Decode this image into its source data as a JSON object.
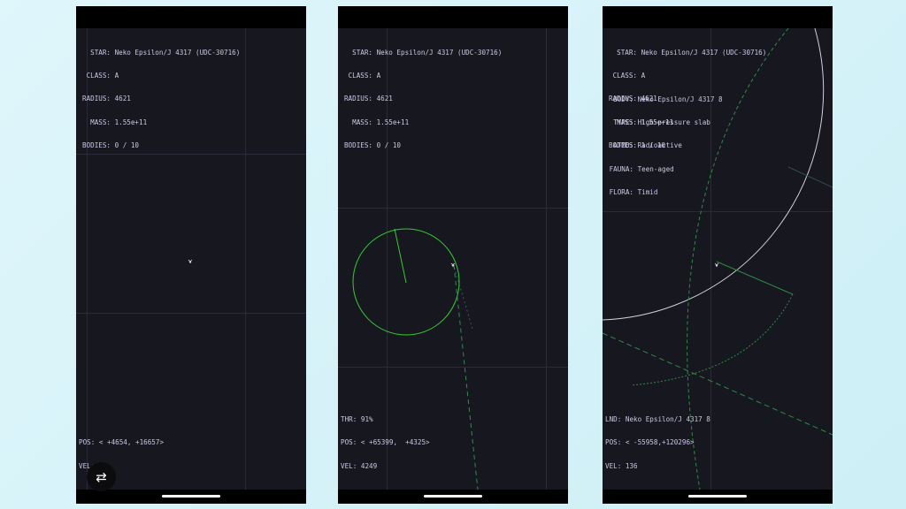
{
  "screens": [
    {
      "star": {
        "star_label": "STAR:",
        "star_value": "Neko Epsilon/J 4317 (UDC-30716)",
        "class_label": "CLASS:",
        "class_value": "A",
        "radius_label": "RADIUS:",
        "radius_value": "4621",
        "mass_label": "MASS:",
        "mass_value": "1.55e+11",
        "bodies_label": "BODIES:",
        "bodies_value": "0 / 10"
      },
      "bottom": {
        "pos_label": "POS:",
        "pos_value": "< +4654, +16657>",
        "vel_label": "VEL:",
        "vel_value": ""
      }
    },
    {
      "star": {
        "star_label": "STAR:",
        "star_value": "Neko Epsilon/J 4317 (UDC-30716)",
        "class_label": "CLASS:",
        "class_value": "A",
        "radius_label": "RADIUS:",
        "radius_value": "4621",
        "mass_label": "MASS:",
        "mass_value": "1.55e+11",
        "bodies_label": "BODIES:",
        "bodies_value": "0 / 10"
      },
      "bottom": {
        "thr_label": "THR:",
        "thr_value": "91%",
        "pos_label": "POS:",
        "pos_value": "< +65399,  +4325>",
        "vel_label": "VEL:",
        "vel_value": "4249"
      }
    },
    {
      "star": {
        "star_label": "STAR:",
        "star_value": "Neko Epsilon/J 4317 (UDC-30716)",
        "class_label": "CLASS:",
        "class_value": "A",
        "radius_label": "RADIUS:",
        "radius_value": "4621",
        "mass_label": "MASS:",
        "mass_value": "1.55e+11",
        "bodies_label": "BODIES:",
        "bodies_value": "1 / 10"
      },
      "body": {
        "body_label": "BODY:",
        "body_value": "Neko Epsilon/J 4317 8",
        "type_label": "TYPE:",
        "type_value": "High-pressure slab",
        "atmo_label": "ATMO:",
        "atmo_value": "Radioactive",
        "fauna_label": "FAUNA:",
        "fauna_value": "Teen-aged",
        "flora_label": "FLORA:",
        "flora_value": "Timid"
      },
      "bottom": {
        "lnd_label": "LND:",
        "lnd_value": "Neko Epsilon/J 4317 8",
        "pos_label": "POS:",
        "pos_value": "< -55958,+120296>",
        "vel_label": "VEL:",
        "vel_value": "136"
      }
    }
  ],
  "fab": {
    "icon": "repeat-icon",
    "glyph": "⇄"
  },
  "colors": {
    "background": "#17171f",
    "grid": "#2a2a38",
    "hud_text": "#c9c9e6",
    "orbit": "#33cc33",
    "planet_outline": "#d0d0e0"
  }
}
